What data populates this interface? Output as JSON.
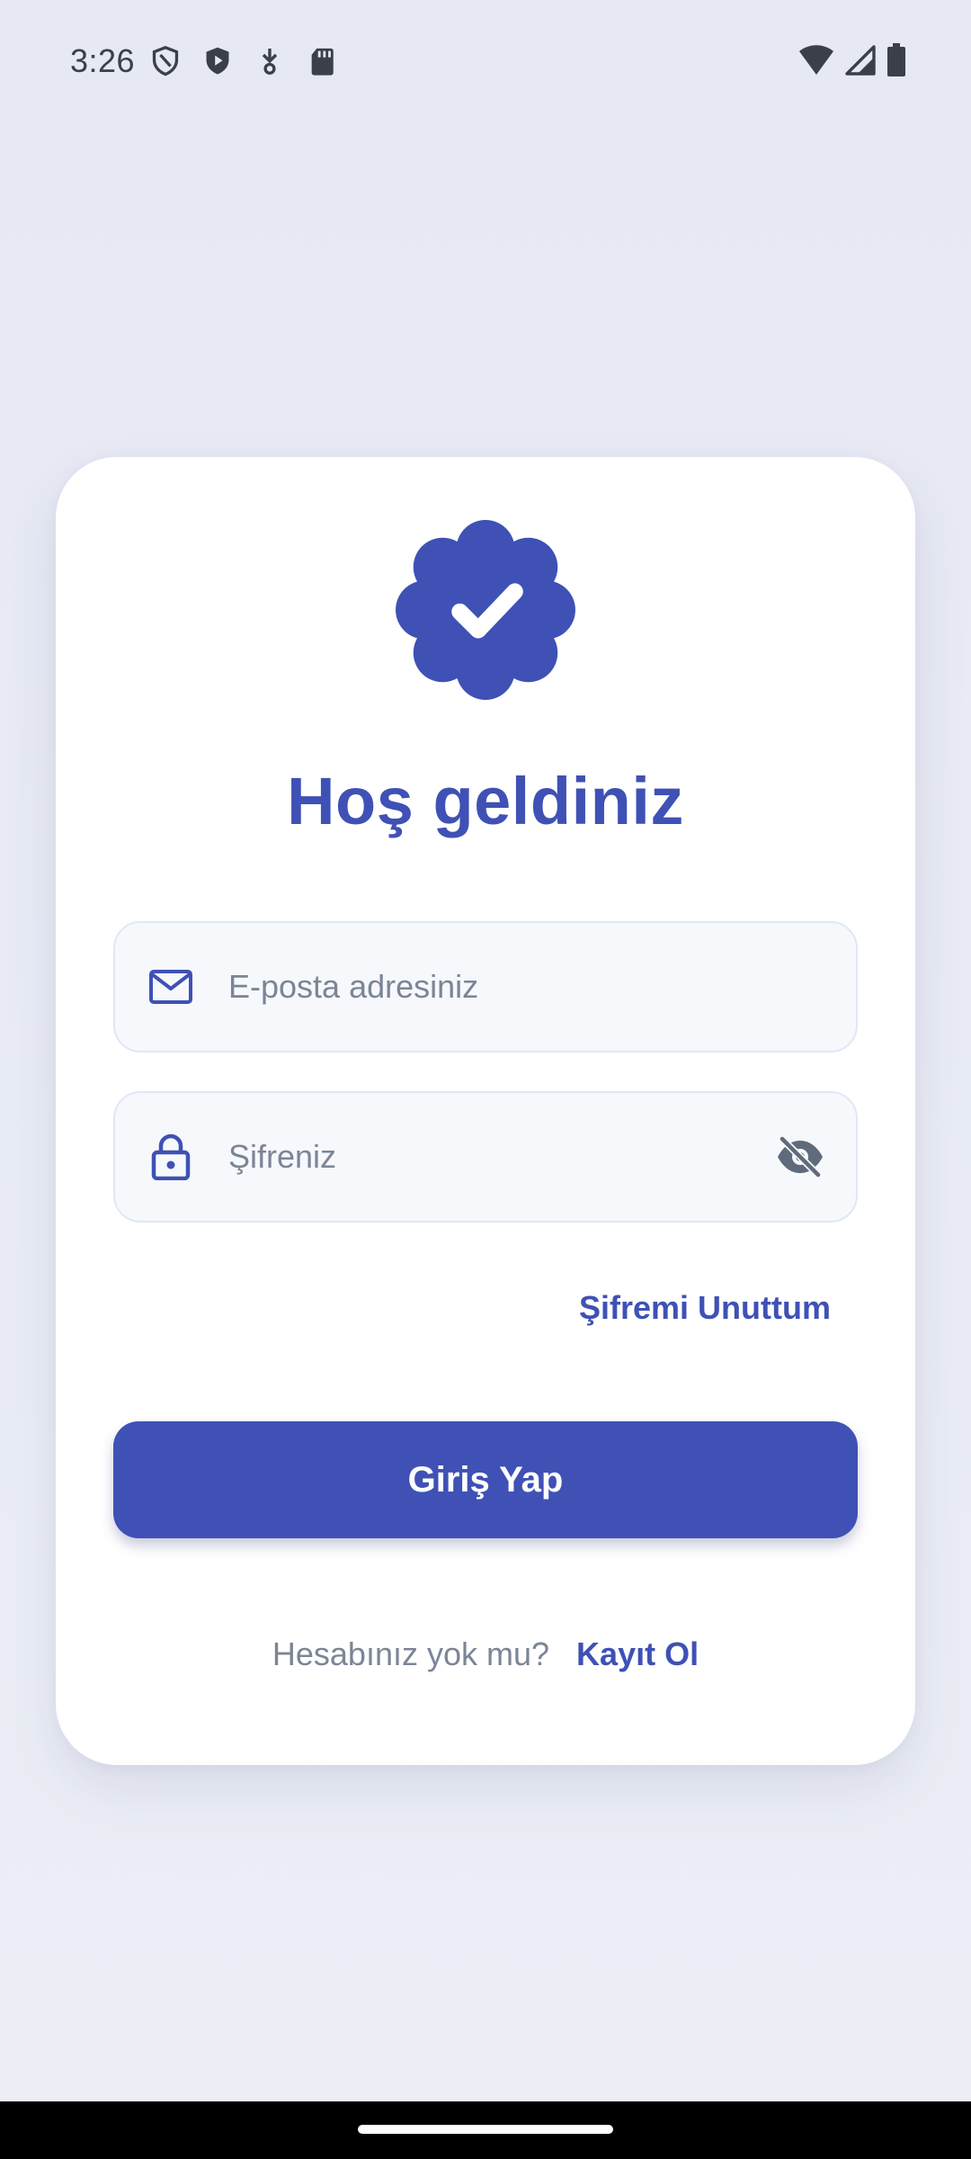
{
  "status_bar": {
    "time": "3:26",
    "left_icons": [
      "shield-outline-icon",
      "shield-play-icon",
      "download-icon",
      "sd-card-icon"
    ],
    "right_icons": [
      "wifi-icon",
      "cellular-signal-icon",
      "battery-icon"
    ]
  },
  "login": {
    "title": "Hoş geldiniz",
    "logo_icon": "verified-badge-icon",
    "email": {
      "icon": "mail-icon",
      "placeholder": "E-posta adresiniz",
      "value": ""
    },
    "password": {
      "icon": "lock-icon",
      "placeholder": "Şifreniz",
      "value": "",
      "toggle_icon": "eye-off-icon"
    },
    "forgot_password": "Şifremi Unuttum",
    "login_button": "Giriş Yap",
    "signup_prompt": "Hesabınız yok mu?",
    "signup_link": "Kayıt Ol"
  },
  "colors": {
    "primary": "#3f51b5",
    "background": "#e6e8f3",
    "card": "#ffffff",
    "field_bg": "#f6f8fc",
    "field_border": "#e0e8f6",
    "muted_text": "#7b8595"
  }
}
